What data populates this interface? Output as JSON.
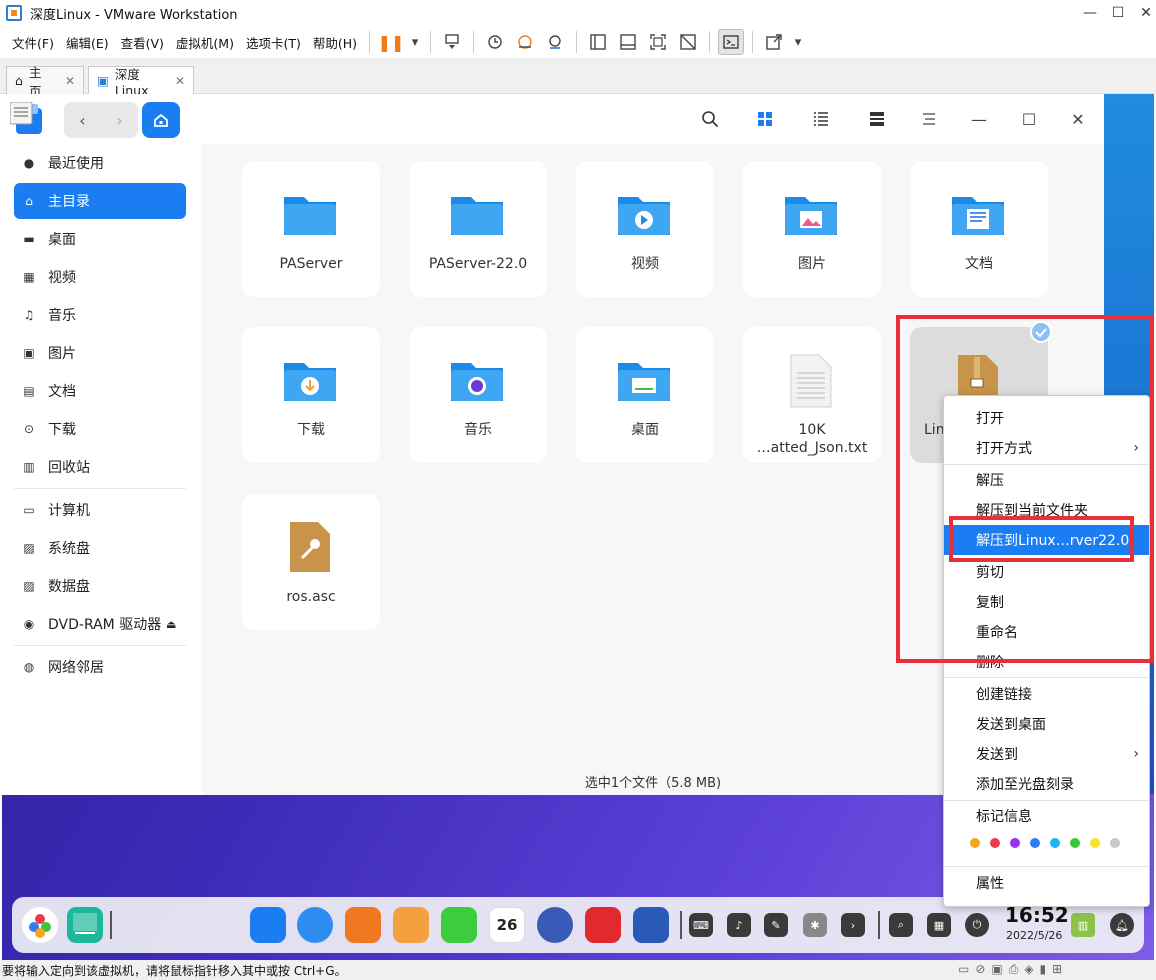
{
  "window": {
    "title": "深度Linux - VMware Workstation"
  },
  "menubar": {
    "items": [
      "文件(F)",
      "编辑(E)",
      "查看(V)",
      "虚拟机(M)",
      "选项卡(T)",
      "帮助(H)"
    ]
  },
  "tabs": [
    {
      "label": "主页"
    },
    {
      "label": "深度Linux"
    }
  ],
  "sidebar": {
    "items": [
      {
        "label": "最近使用",
        "icon": "clock-icon"
      },
      {
        "label": "主目录",
        "icon": "home-icon"
      },
      {
        "label": "桌面",
        "icon": "desktop-icon"
      },
      {
        "label": "视频",
        "icon": "video-icon"
      },
      {
        "label": "音乐",
        "icon": "music-icon"
      },
      {
        "label": "图片",
        "icon": "picture-icon"
      },
      {
        "label": "文档",
        "icon": "document-icon"
      },
      {
        "label": "下载",
        "icon": "download-icon"
      },
      {
        "label": "回收站",
        "icon": "trash-icon"
      },
      {
        "label": "计算机",
        "icon": "computer-icon"
      },
      {
        "label": "系统盘",
        "icon": "disk-icon"
      },
      {
        "label": "数据盘",
        "icon": "disk-icon"
      },
      {
        "label": "DVD-RAM 驱动器",
        "icon": "dvd-icon"
      },
      {
        "label": "网络邻居",
        "icon": "network-icon"
      }
    ]
  },
  "files": [
    {
      "label": "PAServer"
    },
    {
      "label": "PAServer-22.0"
    },
    {
      "label": "视频"
    },
    {
      "label": "图片"
    },
    {
      "label": "文档"
    },
    {
      "label": "下载"
    },
    {
      "label": "音乐"
    },
    {
      "label": "桌面"
    },
    {
      "label": "10K",
      "label2": "…atted_Json.txt"
    },
    {
      "label": "Lin"
    },
    {
      "label": "ros.asc"
    }
  ],
  "status": {
    "text": "选中1个文件（5.8 MB)"
  },
  "context_menu": {
    "items": [
      {
        "label": "打开"
      },
      {
        "label": "打开方式"
      },
      {
        "label": "解压"
      },
      {
        "label": "解压到当前文件夹"
      },
      {
        "label": "解压到Linux…rver22.0"
      },
      {
        "label": "剪切"
      },
      {
        "label": "复制"
      },
      {
        "label": "重命名"
      },
      {
        "label": "删除"
      },
      {
        "label": "创建链接"
      },
      {
        "label": "发送到桌面"
      },
      {
        "label": "发送到"
      },
      {
        "label": "添加至光盘刻录"
      },
      {
        "label": "标记信息"
      },
      {
        "label": "属性"
      }
    ],
    "tag_colors": [
      "#f5a623",
      "#f03a4a",
      "#9b30f2",
      "#2f7cf6",
      "#1fb3f0",
      "#39c53a",
      "#f6e22c",
      "#c8c8c8"
    ]
  },
  "dock": {
    "time": "16:52",
    "date": "2022/5/26",
    "calendar_day": "26"
  },
  "statusbar": {
    "text": "要将输入定向到该虚拟机，请将鼠标指针移入其中或按 Ctrl+G。"
  },
  "colors": {
    "accent": "#1a7df2",
    "highlight_box": "#e8303a"
  }
}
